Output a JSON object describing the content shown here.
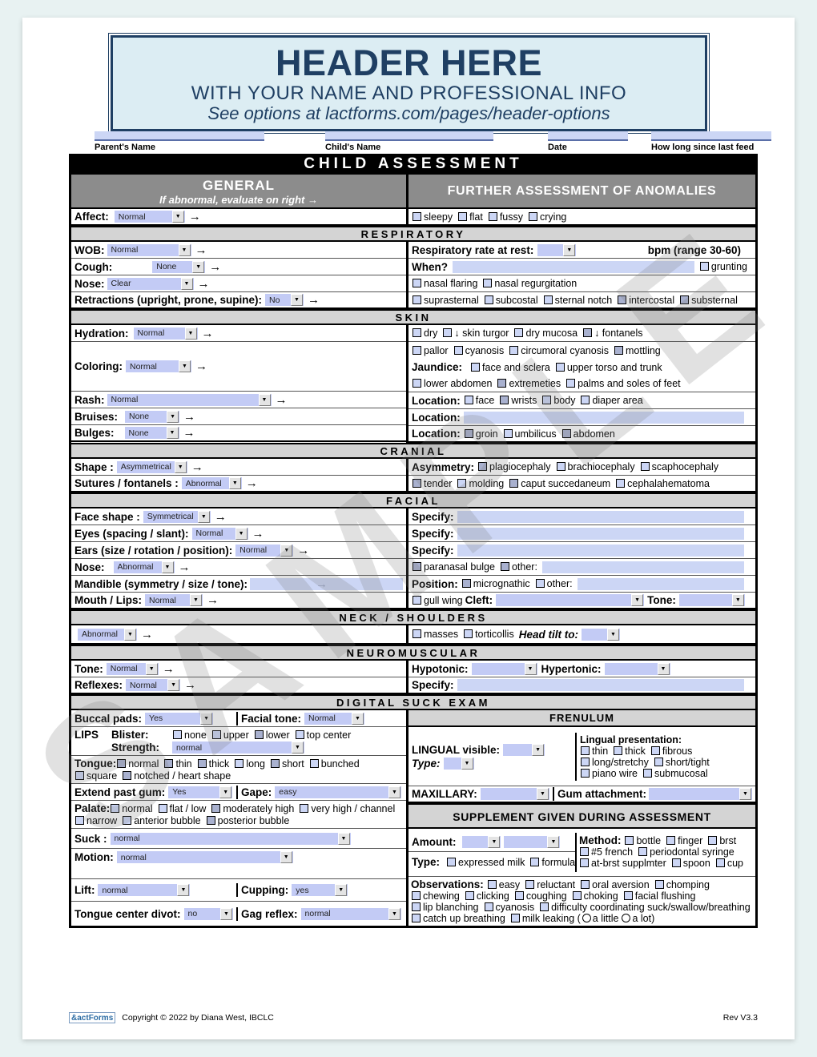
{
  "banner": {
    "line1": "HEADER HERE",
    "line2": "WITH YOUR NAME AND PROFESSIONAL INFO",
    "line3": "See options at lactforms.com/pages/header-options"
  },
  "top_fields": [
    {
      "label": "Parent's Name",
      "value": ""
    },
    {
      "label": "Child's Name",
      "value": ""
    },
    {
      "label": "Date",
      "value": ""
    },
    {
      "label": "How long since last feed",
      "value": ""
    }
  ],
  "title": "CHILD ASSESSMENT",
  "headers": {
    "general": "GENERAL",
    "general_sub": "If abnormal, evaluate on right →",
    "anomalies": "FURTHER ASSESSMENT OF ANOMALIES"
  },
  "sections": {
    "respiratory": "RESPIRATORY",
    "skin": "SKIN",
    "cranial": "CRANIAL",
    "facial": "FACIAL",
    "neck": "NECK / SHOULDERS",
    "neuromuscular": "NEUROMUSCULAR",
    "digital_suck": "DIGITAL SUCK EXAM",
    "frenulum": "FRENULUM",
    "supplement": "SUPPLEMENT GIVEN DURING ASSESSMENT"
  },
  "general": {
    "affect_label": "Affect:",
    "affect_value": "Normal",
    "anom_affect": [
      "sleepy",
      "flat",
      "fussy",
      "crying"
    ]
  },
  "respiratory": {
    "wob_label": "WOB:",
    "wob_value": "Normal",
    "cough_label": "Cough:",
    "cough_value": "None",
    "nose_label": "Nose:",
    "nose_value": "Clear",
    "retractions_label": "Retractions (upright, prone, supine):",
    "retractions_value": "No",
    "rate_label": "Respiratory rate at rest:",
    "rate_value": "",
    "rate_unit": "bpm (range 30-60)",
    "when_label": "When?",
    "when_value": "",
    "grunting": "grunting",
    "flaring": [
      "nasal flaring",
      "nasal regurgitation"
    ],
    "retraction_sites": [
      "suprasternal",
      "subcostal",
      "sternal notch",
      "intercostal",
      "substernal"
    ]
  },
  "skin": {
    "hydration_label": "Hydration:",
    "hydration_value": "Normal",
    "coloring_label": "Coloring:",
    "coloring_value": "Normal",
    "rash_label": "Rash:",
    "rash_value": "Normal",
    "bruises_label": "Bruises:",
    "bruises_value": "None",
    "bulges_label": "Bulges:",
    "bulges_value": "None",
    "hydration_signs": [
      "dry",
      "↓ skin turgor",
      "dry mucosa",
      "↓ fontanels"
    ],
    "color_signs": [
      "pallor",
      "cyanosis",
      "circumoral cyanosis",
      "mottling"
    ],
    "jaundice_label": "Jaundice:",
    "jaundice_1": [
      "face and sclera",
      "upper torso and trunk"
    ],
    "jaundice_2": [
      "lower abdomen",
      "extremeties",
      "palms and soles of feet"
    ],
    "location_label": "Location:",
    "rash_locations": [
      "face",
      "wrists",
      "body",
      "diaper area"
    ],
    "bruise_location_value": "",
    "bulge_locations": [
      "groin",
      "umbilicus",
      "abdomen"
    ]
  },
  "cranial": {
    "shape_label": "Shape :",
    "shape_value": "Asymmetrical",
    "sutures_label": "Sutures / fontanels :",
    "sutures_value": "Abnormal",
    "asymmetry_label": "Asymmetry:",
    "asymmetry_opts": [
      "plagiocephaly",
      "brachiocephaly",
      "scaphocephaly"
    ],
    "suture_opts": [
      "tender",
      "molding",
      "caput succedaneum",
      "cephalahematoma"
    ]
  },
  "facial": {
    "face_label": "Face shape :",
    "face_value": "Symmetrical",
    "eyes_label": "Eyes (spacing / slant):",
    "eyes_value": "Normal",
    "ears_label": "Ears (size / rotation / position):",
    "ears_value": "Normal",
    "nose_label": "Nose:",
    "nose_value": "Abnormal",
    "mandible_label": "Mandible (symmetry / size / tone):",
    "mandible_value": "",
    "mouth_label": "Mouth / Lips:",
    "mouth_value": "Normal",
    "specify_label": "Specify:",
    "specify_1": "",
    "specify_2": "",
    "specify_3": "",
    "nose_opts": [
      "paranasal bulge",
      "other:"
    ],
    "position_label": "Position:",
    "position_opts": [
      "micrognathic",
      "other:"
    ],
    "gull_wing": "gull wing",
    "cleft_label": "Cleft:",
    "cleft_value": "",
    "tone_label": "Tone:",
    "tone_value": ""
  },
  "neck": {
    "value": "Abnormal",
    "opts": [
      "masses",
      "torticollis"
    ],
    "head_tilt_label": "Head tilt to:",
    "head_tilt_value": ""
  },
  "neuromuscular": {
    "tone_label": "Tone:",
    "tone_value": "Normal",
    "reflexes_label": "Reflexes:",
    "reflexes_value": "Normal",
    "hypotonic_label": "Hypotonic:",
    "hypotonic_value": "",
    "hypertonic_label": "Hypertonic:",
    "hypertonic_value": "",
    "specify_label": "Specify:",
    "specify_value": ""
  },
  "digital_suck": {
    "buccal_label": "Buccal pads:",
    "buccal_value": "Yes",
    "facial_tone_label": "Facial tone:",
    "facial_tone_value": "Normal",
    "lips_label": "LIPS",
    "blister_label": "Blister:",
    "blister_opts": [
      "none",
      "upper",
      "lower",
      "top center"
    ],
    "strength_label": "Strength:",
    "strength_value": "normal",
    "tongue_label": "Tongue:",
    "tongue_opts_1": [
      "normal",
      "thin",
      "thick",
      "long",
      "short",
      "bunched"
    ],
    "tongue_opts_2": [
      "square",
      "notched / heart shape"
    ],
    "extend_label": "Extend past gum:",
    "extend_value": "Yes",
    "gape_label": "Gape:",
    "gape_value": "easy",
    "palate_label": "Palate:",
    "palate_opts_1": [
      "normal",
      "flat / low",
      "moderately high",
      "very high / channel"
    ],
    "palate_opts_2": [
      "narrow",
      "anterior bubble",
      "posterior bubble"
    ],
    "suck_label": "Suck :",
    "suck_value": "normal",
    "motion_label": "Motion:",
    "motion_value": "normal",
    "lift_label": "Lift:",
    "lift_value": "normal",
    "cupping_label": "Cupping:",
    "cupping_value": "yes",
    "divot_label": "Tongue center divot:",
    "divot_value": "no",
    "gag_label": "Gag reflex:",
    "gag_value": "normal"
  },
  "frenulum": {
    "lingual_label": "LINGUAL visible:",
    "lingual_value": "",
    "type_label": "Type:",
    "type_value": "",
    "presentation_label": "Lingual presentation:",
    "presentation_opts_1": [
      "thin",
      "thick",
      "fibrous"
    ],
    "presentation_opts_2": [
      "long/stretchy",
      "short/tight"
    ],
    "presentation_opts_3": [
      "piano wire",
      "submucosal"
    ],
    "maxillary_label": "MAXILLARY:",
    "maxillary_value": "",
    "gum_label": "Gum attachment:",
    "gum_value": ""
  },
  "supplement": {
    "amount_label": "Amount:",
    "amount_value": "",
    "amount_unit_value": "",
    "type_label": "Type:",
    "type_opts": [
      "expressed milk",
      "formula"
    ],
    "method_label": "Method:",
    "method_opts_1": [
      "bottle",
      "finger",
      "brst"
    ],
    "method_opts_2": [
      "#5 french",
      "periodontal syringe"
    ],
    "method_opts_3": [
      "at-brst supplmter",
      "spoon",
      "cup"
    ],
    "observations_label": "Observations:",
    "obs_1": [
      "easy",
      "reluctant",
      "oral aversion",
      "chomping"
    ],
    "obs_2": [
      "chewing",
      "clicking",
      "coughing",
      "choking",
      "facial flushing"
    ],
    "obs_3": [
      "lip blanching",
      "cyanosis",
      "difficulty coordinating suck/swallow/breathing"
    ],
    "obs_4_a": "catch up breathing",
    "obs_4_b": "milk leaking (",
    "obs_4_c": "a little",
    "obs_4_d": "a lot)"
  },
  "footer": {
    "logo_text": "actForms",
    "copyright": "Copyright © 2022 by Diana West, IBCLC",
    "revision": "Rev V3.3"
  },
  "watermark": "SAMPLE",
  "colors": {
    "banner_bg": "#dcedf3",
    "banner_fg": "#1f3f63",
    "field_fill": "#ccd6f5",
    "select_fill": "#c3cbf5",
    "band_grey": "#d4d4d4",
    "header_grey": "#8c8c8c"
  }
}
